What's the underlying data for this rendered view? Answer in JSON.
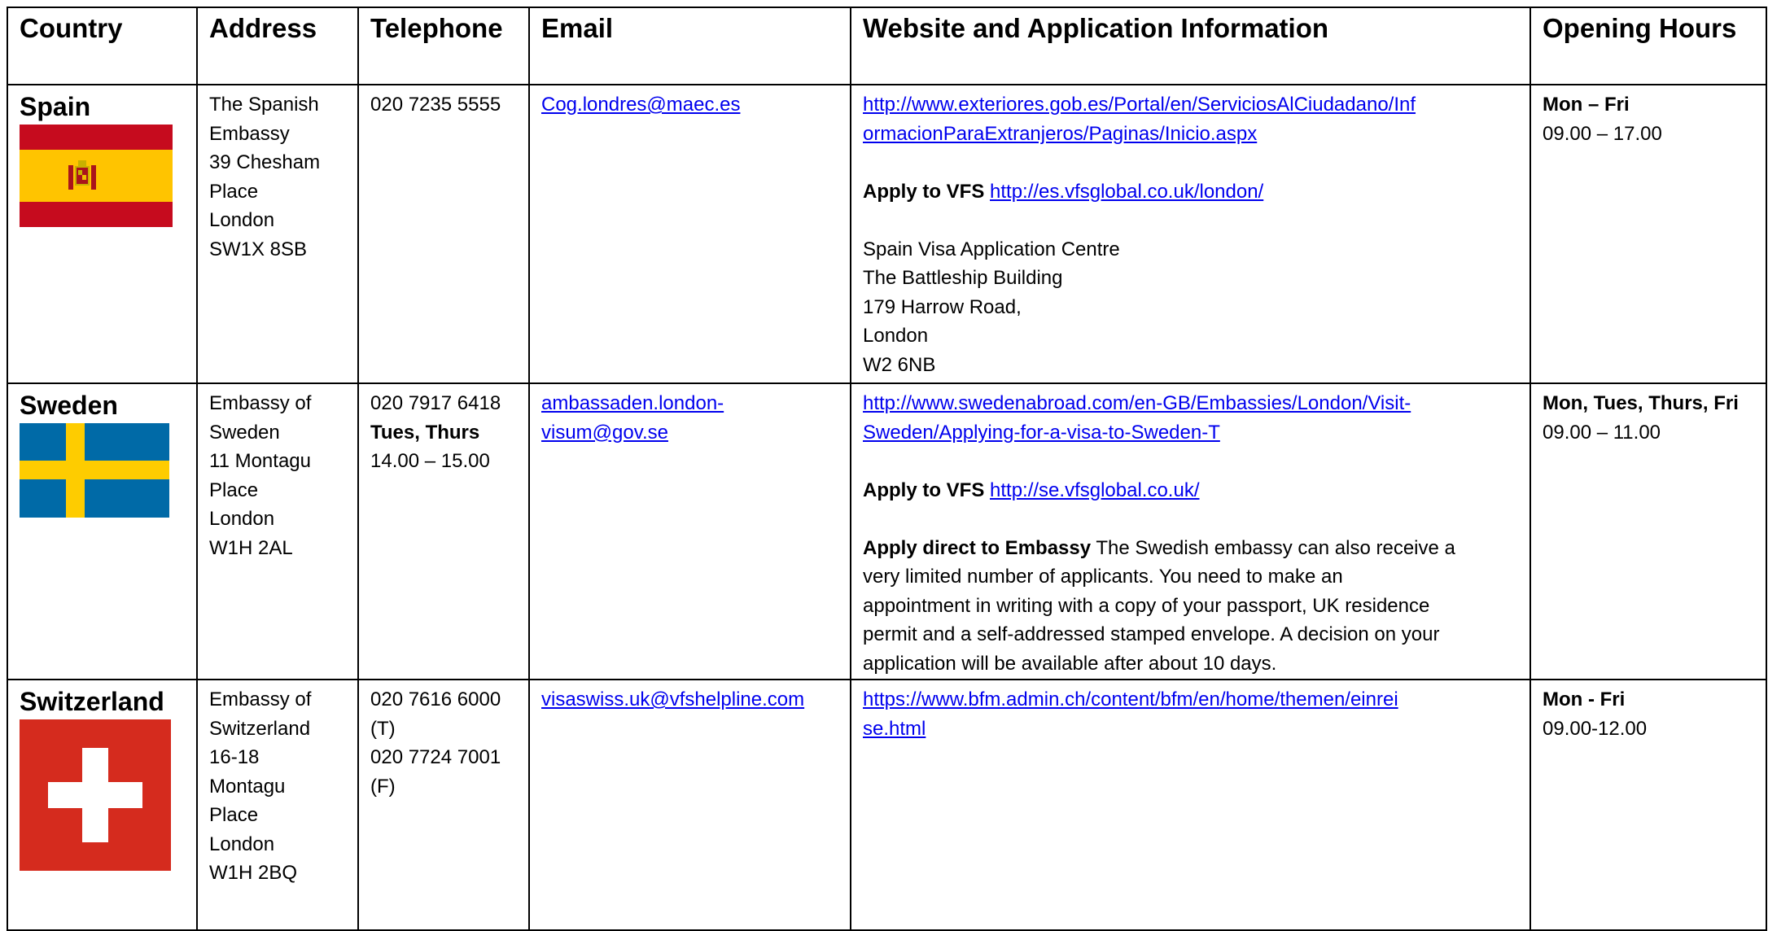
{
  "headers": {
    "country": "Country",
    "address": "Address",
    "telephone": "Telephone",
    "email": "Email",
    "website": "Website and Application Information",
    "hours": "Opening Hours"
  },
  "rows": [
    {
      "country": "Spain",
      "address": [
        "The Spanish",
        "Embassy",
        "39 Chesham",
        "Place",
        "London",
        "SW1X 8SB"
      ],
      "telephone": [
        "020 7235 5555"
      ],
      "email": [
        "Cog.londres@maec.es"
      ],
      "website_url": [
        "http://www.exteriores.gob.es/Portal/en/ServiciosAlCiudadano/Inf",
        "ormacionParaExtranjeros/Paginas/Inicio.aspx"
      ],
      "apply_vfs_label": "Apply to VFS",
      "apply_vfs_url": "http://es.vfsglobal.co.uk/london/",
      "centre": [
        "Spain Visa Application Centre",
        "The Battleship Building",
        "179 Harrow Road,",
        "London",
        "W2 6NB"
      ],
      "hours_days": "Mon – Fri",
      "hours_time": "09.00 – 17.00"
    },
    {
      "country": "Sweden",
      "address": [
        "Embassy of",
        "Sweden",
        "11 Montagu",
        "Place",
        "London",
        "W1H 2AL"
      ],
      "telephone": [
        "020 7917 6418"
      ],
      "telephone_days": "Tues, Thurs",
      "telephone_time": "14.00 – 15.00",
      "email": [
        "ambassaden.london-",
        "visum@gov.se"
      ],
      "website_url": [
        "http://www.swedenabroad.com/en-GB/Embassies/London/Visit-",
        "Sweden/Applying-for-a-visa-to-Sweden-T"
      ],
      "apply_vfs_label": "Apply to VFS",
      "apply_vfs_url": "http://se.vfsglobal.co.uk/",
      "direct_label": "Apply direct to Embassy",
      "direct_text": [
        " The Swedish embassy can also receive a",
        "very limited number of applicants. You need to make an",
        "appointment in writing with a copy of your passport, UK residence",
        "permit and a self-addressed stamped envelope. A decision on your",
        "application will be available after about 10 days."
      ],
      "hours_days": "Mon, Tues, Thurs, Fri",
      "hours_time": "09.00 – 11.00"
    },
    {
      "country": "Switzerland",
      "address": [
        "Embassy of",
        "Switzerland",
        "16-18",
        "Montagu",
        "Place",
        "London",
        "W1H 2BQ"
      ],
      "telephone": [
        "020 7616 6000",
        "(T)",
        "020 7724 7001",
        "(F)"
      ],
      "email": [
        "visaswiss.uk@vfshelpline.com"
      ],
      "website_url": [
        "https://www.bfm.admin.ch/content/bfm/en/home/themen/einrei",
        "se.html"
      ],
      "hours_days": "Mon - Fri",
      "hours_time": "09.00-12.00"
    }
  ],
  "flags": {
    "spain": {
      "red": "#c60b1e",
      "yellow": "#ffc400"
    },
    "sweden": {
      "blue": "#006aa7",
      "yellow": "#fecc00"
    },
    "switzerland": {
      "red": "#d52b1e",
      "white": "#ffffff"
    }
  }
}
